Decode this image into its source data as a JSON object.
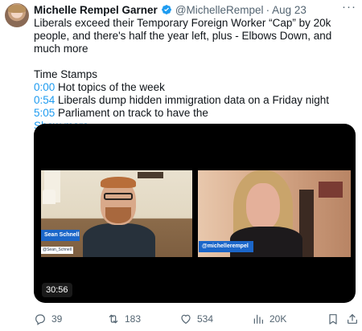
{
  "author": {
    "name": "Michelle Rempel Garner",
    "handle": "@MichelleRempel",
    "date": "Aug 23",
    "separator": "·",
    "verified_color": "#1d9bf0"
  },
  "more_label": "···",
  "text": {
    "line1": "Liberals exceed their Temporary Foreign Worker “Cap” by 20k people, and there's half the year left, plus - Elbows Down, and much more",
    "heading": "Time Stamps",
    "stamps": [
      {
        "time": "0:00",
        "label": " Hot topics of the week"
      },
      {
        "time": "0:54",
        "label": " Liberals dump hidden immigration data on a Friday night"
      },
      {
        "time": "5:05",
        "label": " Parliament on track to have the"
      }
    ],
    "show_more": "Show more"
  },
  "video": {
    "left_name": "Sean Schnell",
    "left_handle": "@Sean_Schnell",
    "right_handle": "@michellerempel",
    "duration": "30:56",
    "tag_color": "#1b66c9"
  },
  "actions": {
    "replies": "39",
    "retweets": "183",
    "likes": "534",
    "views": "20K"
  },
  "colors": {
    "accent": "#1d9bf0",
    "muted": "#536471",
    "text": "#0f1419"
  }
}
